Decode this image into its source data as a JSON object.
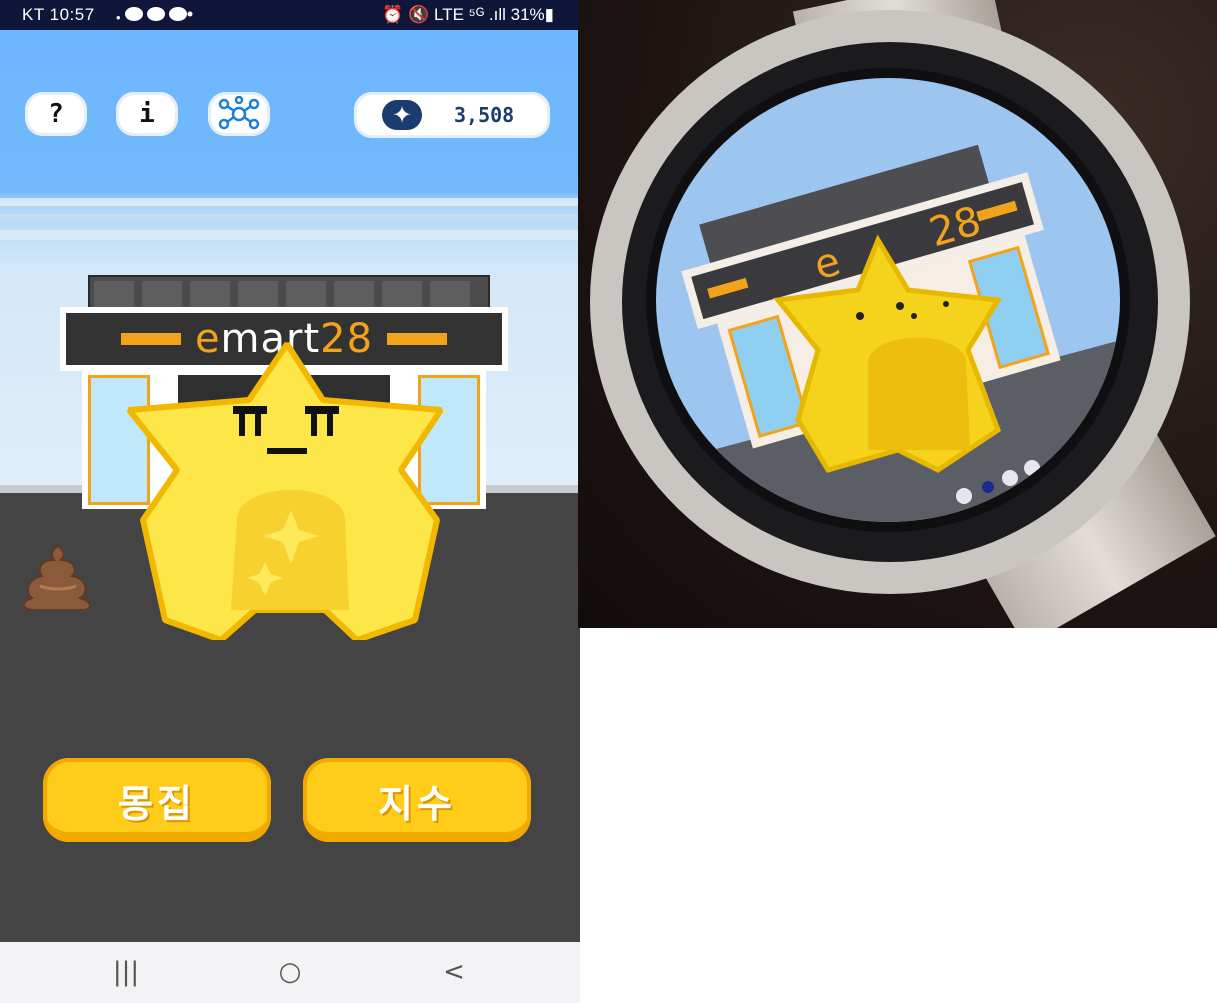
{
  "status_bar": {
    "carrier_time": "KT 10:57",
    "indicators": "• ",
    "right": "⏰ 🔇 LTE ⁵ᴳ .ıll 31%▮"
  },
  "top_bar": {
    "help_label": "?",
    "info_label": "i",
    "network_icon": "network-icon",
    "currency_icon": "sparkle-coin-icon",
    "currency_amount": "3,508"
  },
  "store": {
    "sign_text_a": "e",
    "sign_text_b": "mart",
    "sign_text_c": "28"
  },
  "character": {
    "face": "ㅠ_ㅠ"
  },
  "buttons": {
    "collect_label": "몽집",
    "index_label": "지수"
  },
  "nav": {
    "recent": "|||",
    "home": "○",
    "back": "<"
  },
  "colors": {
    "accent_yellow": "#ffcc1a",
    "sky_blue": "#6db7ff",
    "road": "#444444",
    "coin_blue": "#1c3b6e"
  }
}
